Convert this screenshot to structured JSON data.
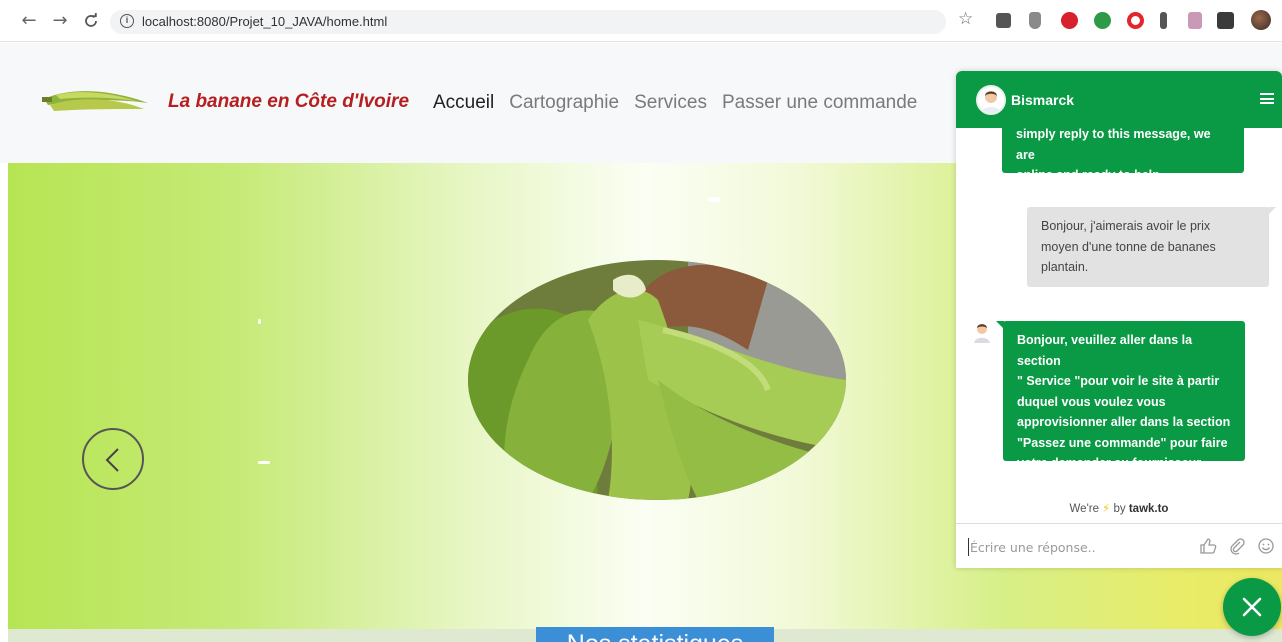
{
  "browser": {
    "url": "localhost:8080/Projet_10_JAVA/home.html",
    "icons": [
      "back-arrow-icon",
      "forward-arrow-icon",
      "reload-icon",
      "info-icon",
      "bookmark-star-icon",
      "extension-icons",
      "profile-avatar"
    ]
  },
  "site": {
    "brand": "La banane en Côte d'Ivoire",
    "nav": [
      "Accueil",
      "Cartographie",
      "Services",
      "Passer une commande"
    ],
    "active_nav": "Accueil"
  },
  "hero": {
    "stats_button": "Nos statistiques"
  },
  "chat": {
    "agent_name": "Bismarck",
    "messages": [
      {
        "from": "agent",
        "lines": [
          "simply reply to this message, we are",
          "online and ready to help."
        ]
      },
      {
        "from": "visitor",
        "lines": [
          "Bonjour, j'aimerais avoir le prix",
          "moyen d'une tonne de bananes",
          "plantain."
        ]
      },
      {
        "from": "agent",
        "lines": [
          "Bonjour, veuillez aller dans la section",
          "\" Service \"pour voir le site à partir",
          "duquel vous voulez vous",
          "approvisionner aller dans la section",
          "\"Passez une commande\" pour faire",
          "votre demander au fournisseur."
        ]
      }
    ],
    "powered_prefix": "We're",
    "powered_by": "by",
    "powered_brand": "tawk.to",
    "input_placeholder": "Écrire une réponse.."
  },
  "colors": {
    "chat_green": "#0a9a45",
    "brand_red": "#b51f1f",
    "stats_blue": "#3b8fd6"
  }
}
